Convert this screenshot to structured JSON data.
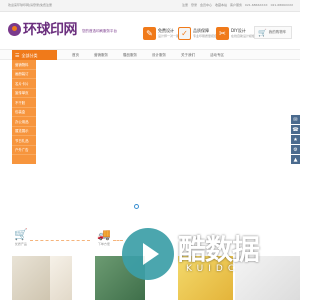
{
  "topbar": {
    "welcome": "欢迎来环球印网|请登录|免费注册",
    "links": [
      "注册",
      "登录",
      "会员中心",
      "收藏本站",
      "客户服务",
      "021-6866XXXX",
      "021-6866XXXX"
    ]
  },
  "header": {
    "logo_text": "环球印网",
    "slogan": "您的首选印刷服务平台",
    "features": [
      {
        "title": "免费设计",
        "sub": "设计师一对一服务",
        "icon": "design-icon"
      },
      {
        "title": "品质保障",
        "sub": "专业印刷质量把控",
        "icon": "quality-icon"
      },
      {
        "title": "DIY设计",
        "sub": "在线自助设计模板",
        "icon": "diy-icon"
      }
    ],
    "cart_label": "我的购物车"
  },
  "nav": {
    "all_label": "全部分类",
    "links": [
      "首页",
      "营销服务",
      "赠品服务",
      "设计服务",
      "关于我们",
      "活动专区"
    ]
  },
  "sidebar": {
    "items": [
      "营销物料",
      "画册装订",
      "名片卡片",
      "宣传单页",
      "不干胶",
      "包装盒",
      "办公用品",
      "展览展示",
      "节日礼品",
      "户外广告"
    ]
  },
  "services": [
    {
      "label": "优质产品",
      "icon": "cart-icon"
    },
    {
      "label": "下单方便",
      "icon": "truck-icon"
    }
  ],
  "watermark": {
    "text": "酷数据",
    "sub": "KUIDC"
  },
  "right_tools": [
    "✉",
    "☎",
    "★",
    "⚙",
    "▲"
  ],
  "colors": {
    "accent": "#f07a1a",
    "brand": "#6b2f7e",
    "sidebar": "#f7953d",
    "play": "#3c9fa8"
  }
}
